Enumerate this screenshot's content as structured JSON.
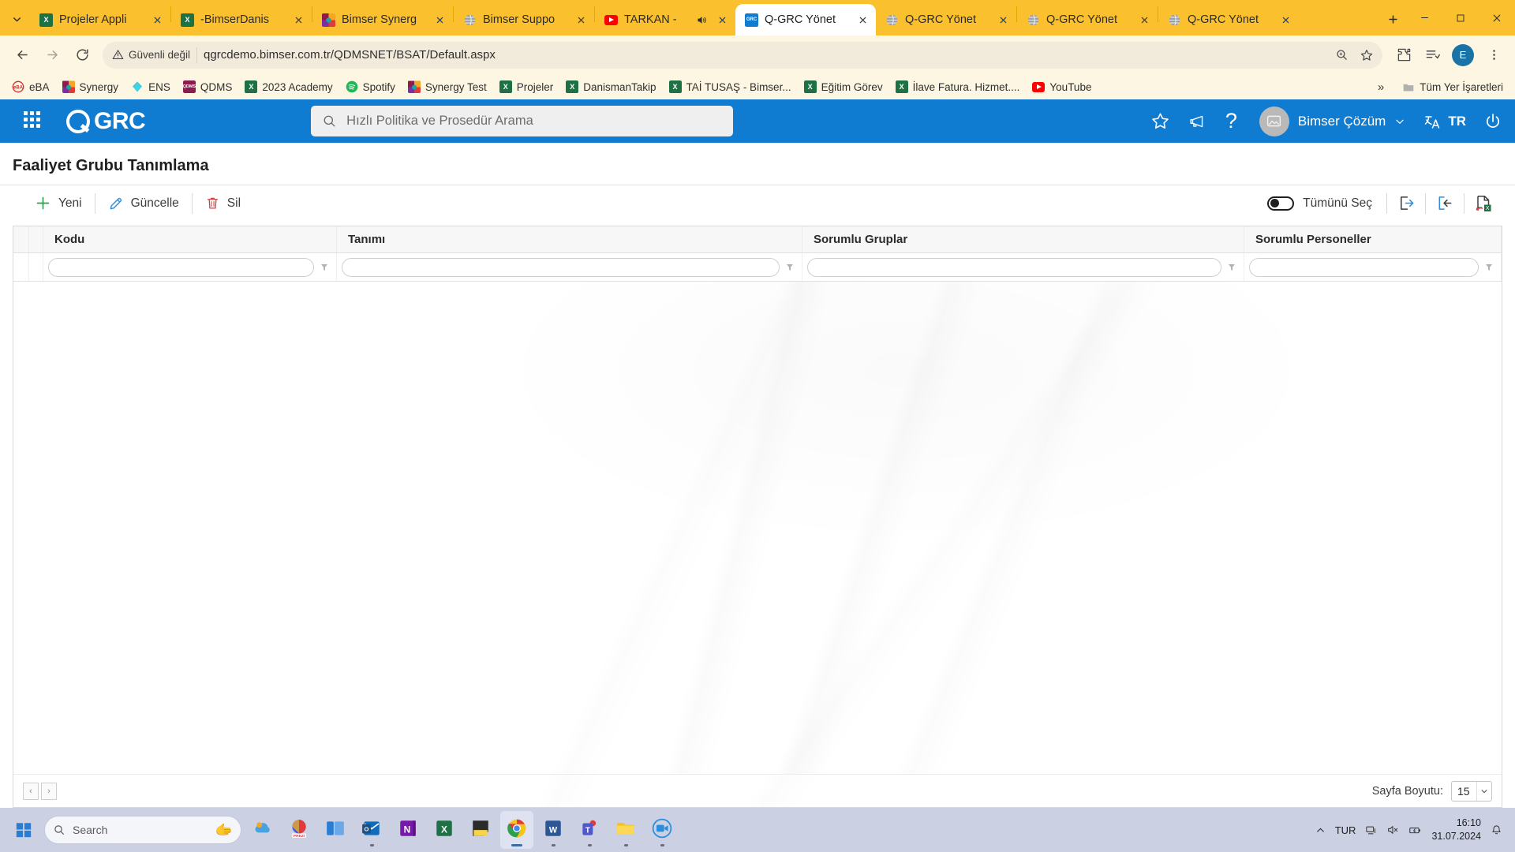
{
  "browser": {
    "tab_search_icon": "chevron-down-icon",
    "tabs": [
      {
        "title": "Projeler Appli",
        "favicon": "excel-icon",
        "active": false,
        "audio": false
      },
      {
        "title": "-BimserDanis",
        "favicon": "excel-icon",
        "active": false,
        "audio": false
      },
      {
        "title": "Bimser Synerg",
        "favicon": "synergy-icon",
        "active": false,
        "audio": false
      },
      {
        "title": "Bimser Suppo",
        "favicon": "globe-icon",
        "active": false,
        "audio": false
      },
      {
        "title": "TARKAN -",
        "favicon": "youtube-icon",
        "active": false,
        "audio": true
      },
      {
        "title": "Q-GRC Yönet",
        "favicon": "qgrc-icon",
        "active": true,
        "audio": false
      },
      {
        "title": "Q-GRC Yönet",
        "favicon": "globe-icon",
        "active": false,
        "audio": false
      },
      {
        "title": "Q-GRC Yönet",
        "favicon": "globe-icon",
        "active": false,
        "audio": false
      },
      {
        "title": "Q-GRC Yönet",
        "favicon": "globe-icon",
        "active": false,
        "audio": false
      }
    ],
    "new_tab_label": "+",
    "window_controls": {
      "minimize": "–",
      "maximize": "☐",
      "close": "✕"
    },
    "nav": {
      "back": "←",
      "forward": "→",
      "reload": "⟳"
    },
    "omnibox": {
      "security_label": "Güvenli değil",
      "security_icon": "warning-triangle-icon",
      "url": "qgrcdemo.bimser.com.tr/QDMSNET/BSAT/Default.aspx",
      "zoom_icon": "zoom-magnifier-icon",
      "bookmark_icon": "star-icon"
    },
    "toolbar_right": {
      "extensions_icon": "puzzle-icon",
      "reading_list_icon": "reading-list-icon",
      "profile_initial": "E",
      "menu_icon": "three-dots-vertical-icon"
    },
    "bookmarks": [
      {
        "label": "eBA",
        "icon": "eba-icon"
      },
      {
        "label": "Synergy",
        "icon": "synergy-icon"
      },
      {
        "label": "ENS",
        "icon": "ens-icon"
      },
      {
        "label": "QDMS",
        "icon": "qdms-icon"
      },
      {
        "label": "2023 Academy",
        "icon": "excel-icon"
      },
      {
        "label": "Spotify",
        "icon": "spotify-icon"
      },
      {
        "label": "Synergy Test",
        "icon": "synergy-icon"
      },
      {
        "label": "Projeler",
        "icon": "excel-icon"
      },
      {
        "label": "DanismanTakip",
        "icon": "excel-icon"
      },
      {
        "label": "TAİ TUSAŞ - Bimser...",
        "icon": "excel-icon"
      },
      {
        "label": "Eğitim Görev",
        "icon": "excel-icon"
      },
      {
        "label": "İlave Fatura. Hizmet....",
        "icon": "excel-icon"
      },
      {
        "label": "YouTube",
        "icon": "youtube-icon"
      }
    ],
    "bookmarks_overflow_icon": "double-chevron-right-icon",
    "all_bookmarks_label": "Tüm Yer İşaretleri",
    "all_bookmarks_icon": "folder-icon"
  },
  "app": {
    "brand": "GRC",
    "apps_grid_icon": "apps-grid-icon",
    "search": {
      "placeholder": "Hızlı Politika ve Prosedür Arama",
      "icon": "search-icon",
      "value": ""
    },
    "header_icons": [
      {
        "name": "favorites-star-icon",
        "glyph": "☆"
      },
      {
        "name": "announcements-megaphone-icon",
        "glyph": "megaphone"
      },
      {
        "name": "help-question-icon",
        "glyph": "?"
      }
    ],
    "user": {
      "name": "Bimser Çözüm",
      "avatar_icon": "user-avatar-icon",
      "chevron": "∨"
    },
    "language": {
      "label": "TR",
      "icon": "translate-icon"
    },
    "power_icon": "power-icon"
  },
  "main": {
    "page_title": "Faaliyet Grubu Tanımlama",
    "toolbar": {
      "new_label": "Yeni",
      "new_icon": "plus-icon",
      "update_label": "Güncelle",
      "update_icon": "pencil-icon",
      "delete_label": "Sil",
      "delete_icon": "trash-icon",
      "select_all_label": "Tümünü Seç",
      "select_all_on": false,
      "export_icon": "export-arrow-right-icon",
      "import_icon": "import-arrow-left-icon",
      "excel_icon": "excel-export-icon"
    },
    "grid": {
      "columns": [
        {
          "header": "Kodu",
          "filter_value": "",
          "filter_icon": "funnel-icon"
        },
        {
          "header": "Tanımı",
          "filter_value": "",
          "filter_icon": "funnel-icon"
        },
        {
          "header": "Sorumlu Gruplar",
          "filter_value": "",
          "filter_icon": "funnel-icon"
        },
        {
          "header": "Sorumlu Personeller",
          "filter_value": "",
          "filter_icon": "funnel-icon"
        }
      ],
      "rows": [],
      "footer": {
        "prev_label": "‹",
        "next_label": "›",
        "page_size_label": "Sayfa Boyutu:",
        "page_size_value": "15"
      }
    }
  },
  "taskbar": {
    "start_icon": "windows-start-icon",
    "search_placeholder": "Search",
    "search_icon": "search-icon",
    "apps": [
      {
        "name": "widgets-weather-icon",
        "active": false,
        "running": false
      },
      {
        "name": "prezi-icon",
        "active": false,
        "running": false
      },
      {
        "name": "task-view-icon",
        "active": false,
        "running": false
      },
      {
        "name": "outlook-icon",
        "active": false,
        "running": true
      },
      {
        "name": "onenote-icon",
        "active": false,
        "running": false
      },
      {
        "name": "excel-icon",
        "active": false,
        "running": false
      },
      {
        "name": "sticky-notes-icon",
        "active": false,
        "running": false
      },
      {
        "name": "chrome-icon",
        "active": true,
        "running": true
      },
      {
        "name": "word-icon",
        "active": false,
        "running": true
      },
      {
        "name": "teams-icon",
        "active": false,
        "running": true
      },
      {
        "name": "file-explorer-icon",
        "active": false,
        "running": true
      },
      {
        "name": "zoom-app-icon",
        "active": false,
        "running": true
      }
    ],
    "tray": {
      "overflow_icon": "chevron-up-icon",
      "language": "TUR",
      "network_icon": "network-icon",
      "volume_icon": "volume-muted-icon",
      "battery_icon": "battery-icon",
      "time": "16:10",
      "date": "31.07.2024",
      "notification_icon": "bell-icon"
    }
  },
  "colors": {
    "chrome_tabstrip": "#fbc02d",
    "chrome_surface": "#fdf6e3",
    "app_header": "#0f7bd1",
    "accent_green": "#2e9e4f",
    "accent_red": "#e03b3b",
    "accent_blue": "#2b8ddb",
    "taskbar": "#ccd0e3"
  }
}
